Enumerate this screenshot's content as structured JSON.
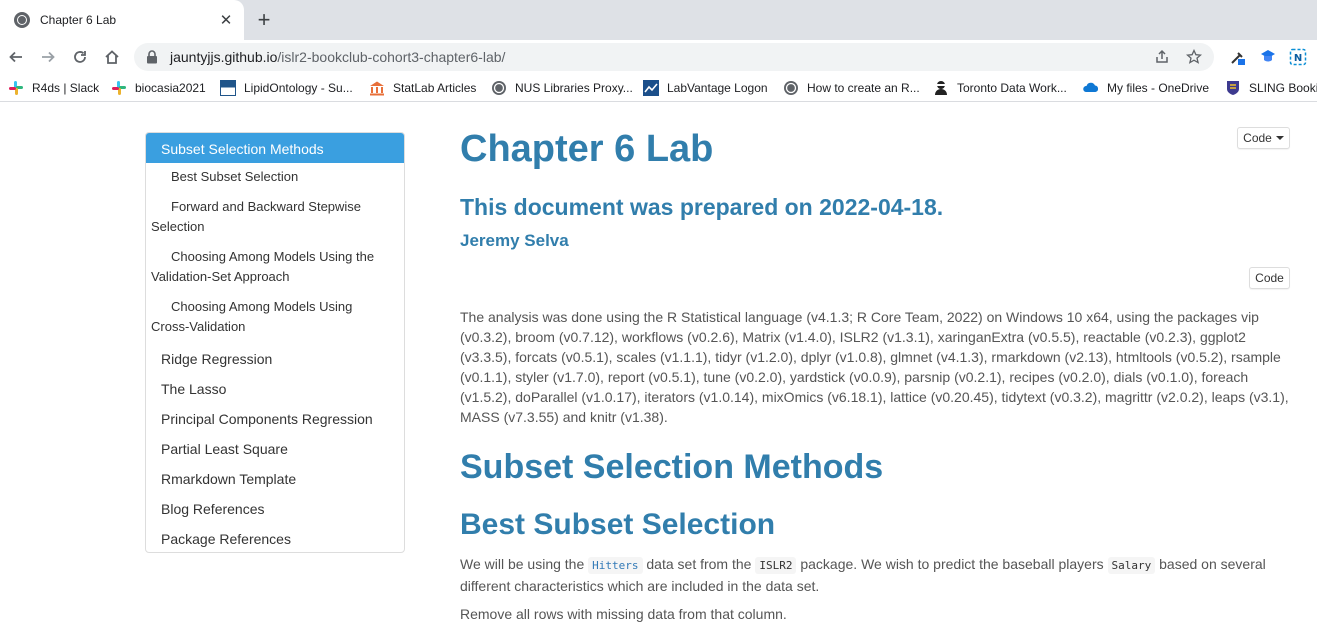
{
  "browser": {
    "tab_title": "Chapter 6 Lab",
    "tab_close": "✕",
    "new_tab": "+",
    "url_host": "jauntyjjs.github.io",
    "url_path": "/islr2-bookclub-cohort3-chapter6-lab/",
    "bookmarks": [
      {
        "label": "R4ds | Slack",
        "icon": "slack-icon"
      },
      {
        "label": "biocasia2021",
        "icon": "slack-icon"
      },
      {
        "label": "LipidOntology - Su...",
        "icon": "ncbi-icon"
      },
      {
        "label": "StatLab Articles",
        "icon": "library-icon"
      },
      {
        "label": "NUS Libraries Proxy...",
        "icon": "globe-icon"
      },
      {
        "label": "LabVantage Logon",
        "icon": "labvantage-icon"
      },
      {
        "label": "How to create an R...",
        "icon": "globe-icon"
      },
      {
        "label": "Toronto Data Work...",
        "icon": "person-icon"
      },
      {
        "label": "My files - OneDrive",
        "icon": "cloud-icon"
      },
      {
        "label": "SLING Booking",
        "icon": "sling-icon"
      }
    ]
  },
  "toc": {
    "items": [
      {
        "label": "Subset Selection Methods",
        "level": 1,
        "active": true
      },
      {
        "label": "Best Subset Selection",
        "level": 2
      },
      {
        "label": "Forward and Backward Stepwise Selection",
        "level": 2
      },
      {
        "label": "Choosing Among Models Using the Validation-Set Approach",
        "level": 2
      },
      {
        "label": "Choosing Among Models Using Cross-Validation",
        "level": 2
      },
      {
        "label": "Ridge Regression",
        "level": 1
      },
      {
        "label": "The Lasso",
        "level": 1
      },
      {
        "label": "Principal Components Regression",
        "level": 1
      },
      {
        "label": "Partial Least Square",
        "level": 1
      },
      {
        "label": "Rmarkdown Template",
        "level": 1
      },
      {
        "label": "Blog References",
        "level": 1
      },
      {
        "label": "Package References",
        "level": 1
      }
    ]
  },
  "doc": {
    "code_dropdown_label": "Code",
    "code_button_label": "Code",
    "title": "Chapter 6 Lab",
    "subtitle": "This document was prepared on 2022-04-18.",
    "author": "Jeremy Selva",
    "session_info": "The analysis was done using the R Statistical language (v4.1.3; R Core Team, 2022) on Windows 10 x64, using the packages vip (v0.3.2), broom (v0.7.12), workflows (v0.2.6), Matrix (v1.4.0), ISLR2 (v1.3.1), xaringanExtra (v0.5.5), reactable (v0.2.3), ggplot2 (v3.3.5), forcats (v0.5.1), scales (v1.1.1), tidyr (v1.2.0), dplyr (v1.0.8), glmnet (v4.1.3), rmarkdown (v2.13), htmltools (v0.5.2), rsample (v0.1.1), styler (v1.7.0), report (v0.5.1), tune (v0.2.0), yardstick (v0.0.9), parsnip (v0.2.1), recipes (v0.2.0), dials (v0.1.0), foreach (v1.5.2), doParallel (v1.0.17), iterators (v1.0.14), mixOmics (v6.18.1), lattice (v0.20.45), tidytext (v0.3.2), magrittr (v2.0.2), leaps (v3.1), MASS (v7.3.55) and knitr (v1.38).",
    "h1": "Subset Selection Methods",
    "h2": "Best Subset Selection",
    "p2_a": "We will be using the ",
    "p2_code1": "Hitters",
    "p2_b": " data set from the ",
    "p2_code2": "ISLR2",
    "p2_c": " package. We wish to predict the baseball players ",
    "p2_code3": "Salary",
    "p2_d": " based on several different characteristics which are included in the data set.",
    "p3": "Remove all rows with missing data from that column."
  }
}
